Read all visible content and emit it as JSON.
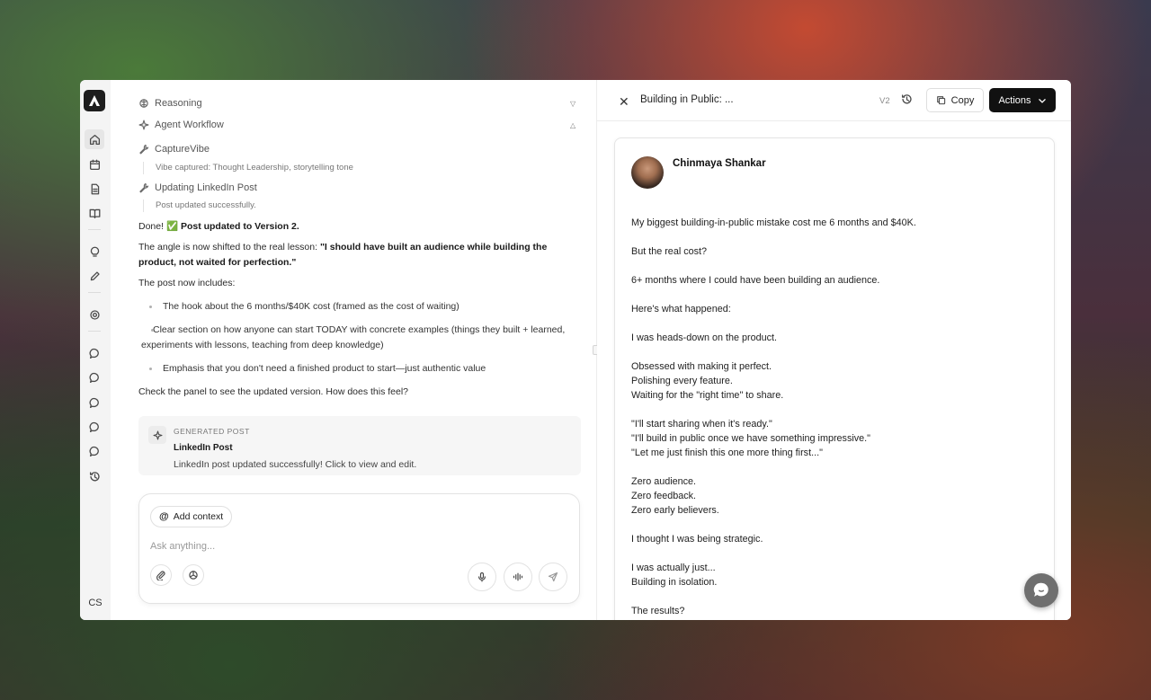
{
  "app": {
    "user_initials": "CS"
  },
  "chat": {
    "reasoning_label": "Reasoning",
    "agent_workflow_label": "Agent Workflow",
    "steps": [
      {
        "title": "CaptureVibe",
        "detail": "Vibe captured: Thought Leadership, storytelling tone"
      },
      {
        "title": "Updating LinkedIn Post",
        "detail": "Post updated successfully."
      }
    ],
    "done_prefix": "Done! ",
    "done_check": "✅",
    "done_bold": "Post updated to Version 2.",
    "angle_prefix": "The angle is now shifted to the real lesson: ",
    "angle_quote": "\"I should have built an audience while building the product, not waited for perfection.\"",
    "includes_label": "The post now includes:",
    "bullets": [
      "The hook about the 6 months/$40K cost (framed as the cost of waiting)",
      "Clear section on how anyone can start TODAY with concrete examples (things they built + learned, experiments with lessons, teaching from deep knowledge)",
      "Emphasis that you don't need a finished product to start—just authentic value"
    ],
    "check_panel": "Check the panel to see the updated version. How does this feel?",
    "generated_card": {
      "label": "GENERATED POST",
      "title": "LinkedIn Post",
      "description": "LinkedIn post updated successfully! Click to view and edit."
    },
    "composer": {
      "add_context_label": "Add context",
      "placeholder": "Ask anything..."
    }
  },
  "panel": {
    "title": "Building in Public: ...",
    "version": "V2",
    "copy_label": "Copy",
    "actions_label": "Actions",
    "post": {
      "author": "Chinmaya Shankar",
      "paragraphs": [
        [
          "My biggest building-in-public mistake cost me 6 months and $40K."
        ],
        [
          "But the real cost?"
        ],
        [
          "6+ months where I could have been building an audience."
        ],
        [
          "Here's what happened:"
        ],
        [
          "I was heads-down on the product."
        ],
        [
          "Obsessed with making it perfect.",
          "Polishing every feature.",
          "Waiting for the \"right time\" to share."
        ],
        [
          "\"I'll start sharing when it's ready.\"",
          "\"I'll build in public once we have something impressive.\"",
          "\"Let me just finish this one more thing first...\""
        ],
        [
          "Zero audience.",
          "Zero feedback.",
          "Zero early believers."
        ],
        [
          "I thought I was being strategic."
        ],
        [
          "I was actually just...",
          "Building in isolation."
        ],
        [
          "The results?"
        ]
      ]
    }
  }
}
